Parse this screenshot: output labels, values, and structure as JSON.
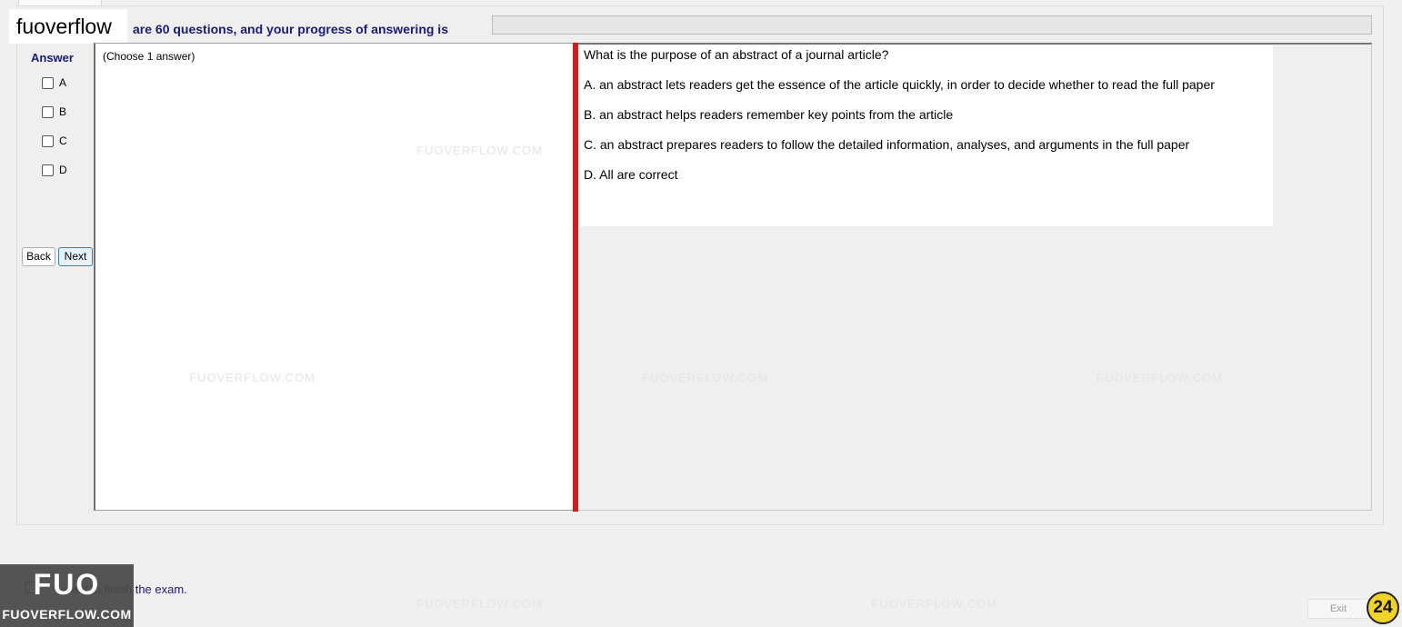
{
  "brand": {
    "text": "fuoverflow"
  },
  "header": {
    "progress_text": "are 60 questions, and your progress of answering is",
    "progress_fraction": 0
  },
  "answer": {
    "label": "Answer",
    "options": [
      "A",
      "B",
      "C",
      "D"
    ],
    "choose_hint": "(Choose 1 answer)"
  },
  "nav": {
    "back_label": "Back",
    "next_label": "Next"
  },
  "question": {
    "text": "What is the purpose of an abstract of a journal article?",
    "choices": [
      "A.  an abstract lets readers get the essence of the article quickly, in order to decide whether to read the full paper",
      "B.  an abstract helps readers remember key points from the article",
      "C.  an abstract prepares readers to follow the detailed information, analyses, and arguments in the full paper",
      "D.  All are correct"
    ]
  },
  "watermark_text": "FUOVERFLOW.COM",
  "footer": {
    "finish_text": "I want to finish the exam.",
    "exit_label": "Exit",
    "page_badge": "24"
  },
  "logo": {
    "big": "FUO",
    "small": "FUOVERFLOW.COM"
  },
  "colors": {
    "accent_text": "#1a1a7a",
    "splitter": "#cc1f1f",
    "badge": "#f2d32a"
  }
}
